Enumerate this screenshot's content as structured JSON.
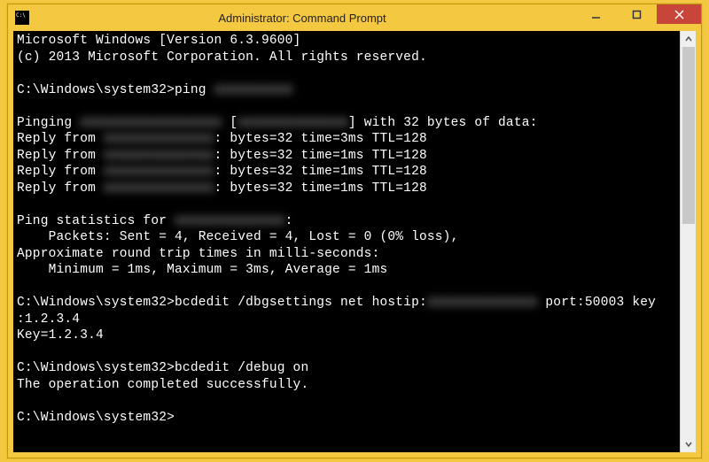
{
  "titlebar": {
    "title": "Administrator: Command Prompt"
  },
  "terminal": {
    "lines": [
      {
        "t": "Microsoft Windows [Version 6.3.9600]"
      },
      {
        "t": "(c) 2013 Microsoft Corporation. All rights reserved."
      },
      {
        "t": ""
      },
      {
        "segments": [
          {
            "t": "C:\\Windows\\system32>ping "
          },
          {
            "t": "xxxxxxxxxx",
            "redacted": true
          }
        ]
      },
      {
        "t": ""
      },
      {
        "segments": [
          {
            "t": "Pinging "
          },
          {
            "t": "xxxxxxxxxxxxxxxxxx",
            "redacted": true
          },
          {
            "t": " ["
          },
          {
            "t": "xxxxxxxxxxxxxx",
            "redacted": true
          },
          {
            "t": "] with 32 bytes of data:"
          }
        ]
      },
      {
        "segments": [
          {
            "t": "Reply from "
          },
          {
            "t": "xxxxxxxxxxxxxx",
            "redacted": true
          },
          {
            "t": ": bytes=32 time=3ms TTL=128"
          }
        ]
      },
      {
        "segments": [
          {
            "t": "Reply from "
          },
          {
            "t": "xxxxxxxxxxxxxx",
            "redacted": true
          },
          {
            "t": ": bytes=32 time=1ms TTL=128"
          }
        ]
      },
      {
        "segments": [
          {
            "t": "Reply from "
          },
          {
            "t": "xxxxxxxxxxxxxx",
            "redacted": true
          },
          {
            "t": ": bytes=32 time=1ms TTL=128"
          }
        ]
      },
      {
        "segments": [
          {
            "t": "Reply from "
          },
          {
            "t": "xxxxxxxxxxxxxx",
            "redacted": true
          },
          {
            "t": ": bytes=32 time=1ms TTL=128"
          }
        ]
      },
      {
        "t": ""
      },
      {
        "segments": [
          {
            "t": "Ping statistics for "
          },
          {
            "t": "xxxxxxxxxxxxxx",
            "redacted": true
          },
          {
            "t": ":"
          }
        ]
      },
      {
        "t": "    Packets: Sent = 4, Received = 4, Lost = 0 (0% loss),"
      },
      {
        "t": "Approximate round trip times in milli-seconds:"
      },
      {
        "t": "    Minimum = 1ms, Maximum = 3ms, Average = 1ms"
      },
      {
        "t": ""
      },
      {
        "segments": [
          {
            "t": "C:\\Windows\\system32>bcdedit /dbgsettings net hostip:"
          },
          {
            "t": "xxxxxxxxxxxxxx",
            "redacted": true
          },
          {
            "t": " port:50003 key"
          }
        ]
      },
      {
        "t": ":1.2.3.4"
      },
      {
        "t": "Key=1.2.3.4"
      },
      {
        "t": ""
      },
      {
        "t": "C:\\Windows\\system32>bcdedit /debug on"
      },
      {
        "t": "The operation completed successfully."
      },
      {
        "t": ""
      },
      {
        "t": "C:\\Windows\\system32>"
      }
    ]
  }
}
